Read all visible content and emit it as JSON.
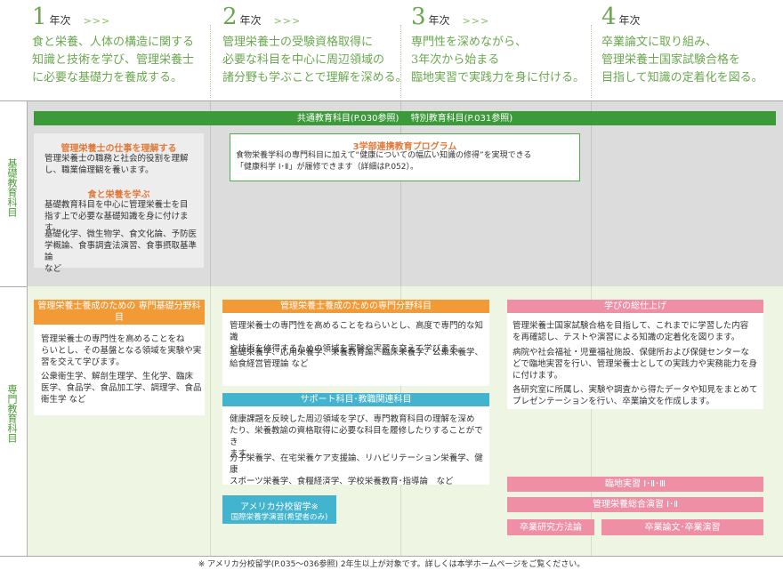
{
  "years": [
    {
      "num": "1",
      "label": "年次",
      "arrow": ">>>",
      "desc": "食と栄養、人体の構造に関する\n知識と技術を学び、管理栄養士\nに必要な基礎力を養成する。"
    },
    {
      "num": "2",
      "label": "年次",
      "arrow": ">>>",
      "desc": "管理栄養士の受験資格取得に\n必要な科目を中心に周辺領域の\n諸分野も学ぶことで理解を深める。"
    },
    {
      "num": "3",
      "label": "年次",
      "arrow": ">>>",
      "desc": "専門性を深めながら、\n3年次から始まる\n臨地実習で実践力を身に付ける。"
    },
    {
      "num": "4",
      "label": "年次",
      "arrow": "",
      "desc": "卒業論文に取り組み、\n管理栄養士国家試験合格を\n目指して知識の定着化を図る。"
    }
  ],
  "sections": {
    "basic": "基礎教育科目",
    "specialized": "専門教育科目"
  },
  "common_bar": "共通教育科目(P.030参照)　 特別教育科目(P.031参照)",
  "basic_box": {
    "h1": "管理栄養士の仕事を理解する",
    "t1": "管理栄養士の職務と社会的役割を理解\nし、職業倫理観を養います。",
    "h2": "食と栄養を学ぶ",
    "t2": "基礎教育科目を中心に管理栄養士を目\n指す上で必要な基礎知識を身に付けます。",
    "t3": "基礎化学、微生物学、食文化論、予防医\n学概論、食事調査法演習、食事摂取基準論\nなど"
  },
  "program_box": {
    "title": "3学部連携教育プログラム",
    "text": "食物栄養学科の専門科目に加えて“健康についての幅広い知識の修得”を実現できる\n「健康科学 Ⅰ･Ⅱ」が履修できます（詳細はP.052）。"
  },
  "foundation": {
    "title": "管理栄養士養成のための\n専門基礎分野科目",
    "t1": "管理栄養士の専門性を高めることをね\nらいとし、その基盤となる領域を実験や実\n習を交えて学びます。",
    "t2": "公衆衛生学、解剖生理学、生化学、臨床\n医学、食品学、食品加工学、調理学、食品\n衛生学 など"
  },
  "specialty": {
    "title": "管理栄養士養成のための専門分野科目",
    "t1": "管理栄養士の専門性を高めることをねらいとし、高度で専門的な知識\nや技術を修得するための領域を実験や実習を交えて学びます。",
    "t2": "基礎栄養学、応用栄養学、栄養教育論、臨床栄養学、公衆栄養学、\n給食経営管理論 など"
  },
  "support": {
    "title": "サポート科目･教職関連科目",
    "t1": "健康課題を反映した周辺領域を学び、専門教育科目の理解を深め\nたり、栄養教諭の資格取得に必要な科目を履修したりすることができ\nます。",
    "t2": "分子栄養学、在宅栄養ケア支援論、リハビリテーション栄養学、健康\nスポーツ栄養学、食糧経済学、学校栄養教育･指導論　など"
  },
  "america": {
    "title": "アメリカ分校留学※",
    "sub": "国際栄養学演習(希望者のみ)"
  },
  "finish": {
    "title": "学びの総仕上げ",
    "t1": "管理栄養士国家試験合格を目指して、これまでに学習した内容\nを再確認し、テストや演習による知識の定着化を図ります。",
    "t2": "病院や社会福祉・児童福祉施設、保健所および保健センターな\nどで臨地実習を行い、管理栄養士としての実践力や実務能力を身\nに付けます。",
    "t3": "各研究室に所属し、実験や調査から得たデータや知見をまとめて\nプレゼンテーションを行い、卒業論文を作成します。"
  },
  "pink_bars": {
    "rinchi": "臨地実習 Ⅰ･Ⅱ･Ⅲ",
    "sogo": "管理栄養総合演習 Ⅰ･Ⅱ",
    "hoho": "卒業研究方法論",
    "ronbun": "卒業論文･卒業演習"
  },
  "footnote": "※ アメリカ分校留学(P.035〜036参照) 2年生以上が対象です。詳しくは本学ホームページをご覧ください。",
  "colors": {
    "green": "#3d9a3a",
    "orange": "#f19a36",
    "teal": "#43b4cf",
    "pink": "#ee8fa6",
    "gray_band": "#dcdcdc",
    "green_band": "#eef6e3",
    "heading_red": "#e07a3b"
  }
}
